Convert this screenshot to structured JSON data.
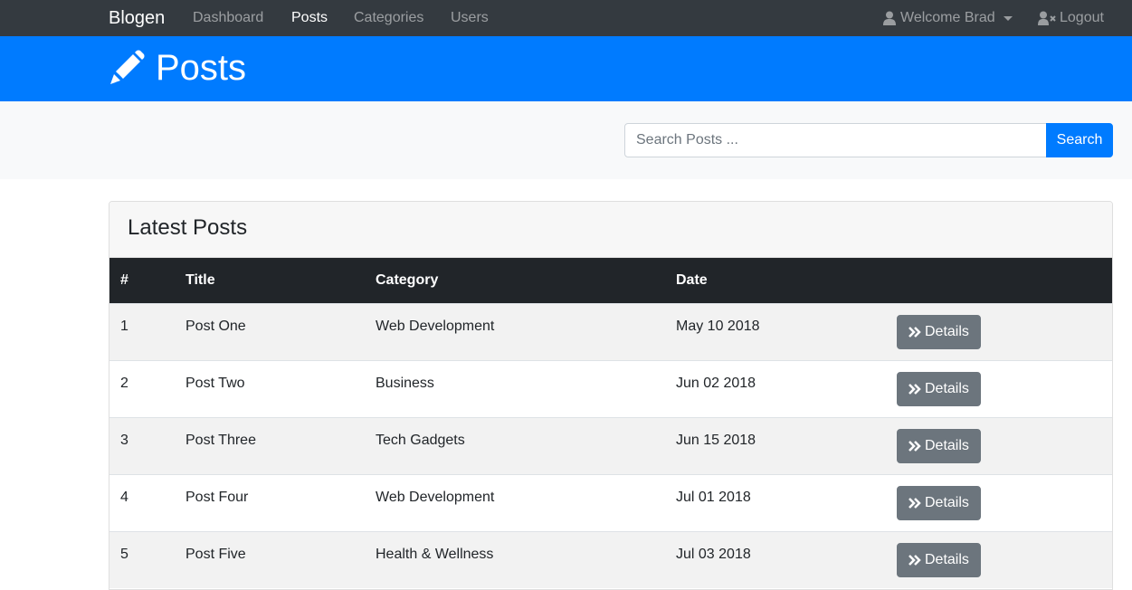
{
  "navbar": {
    "brand": "Blogen",
    "links": [
      {
        "label": "Dashboard",
        "active": false
      },
      {
        "label": "Posts",
        "active": true
      },
      {
        "label": "Categories",
        "active": false
      },
      {
        "label": "Users",
        "active": false
      }
    ],
    "user_label": "Welcome Brad",
    "user_icon": "user-icon",
    "logout_label": "Logout",
    "logout_icon": "user-times-icon"
  },
  "header": {
    "title": "Posts",
    "icon": "pencil-icon",
    "color": "#007bff"
  },
  "search": {
    "placeholder": "Search Posts ...",
    "button_label": "Search"
  },
  "card": {
    "title": "Latest Posts",
    "columns": [
      "#",
      "Title",
      "Category",
      "Date",
      ""
    ],
    "rows": [
      {
        "num": "1",
        "title": "Post One",
        "category": "Web Development",
        "date": "May 10 2018",
        "action": "Details"
      },
      {
        "num": "2",
        "title": "Post Two",
        "category": "Business",
        "date": "Jun 02 2018",
        "action": "Details"
      },
      {
        "num": "3",
        "title": "Post Three",
        "category": "Tech Gadgets",
        "date": "Jun 15 2018",
        "action": "Details"
      },
      {
        "num": "4",
        "title": "Post Four",
        "category": "Web Development",
        "date": "Jul 01 2018",
        "action": "Details"
      },
      {
        "num": "5",
        "title": "Post Five",
        "category": "Health & Wellness",
        "date": "Jul 03 2018",
        "action": "Details"
      }
    ]
  },
  "colors": {
    "navbar_bg": "#343a40",
    "primary": "#007bff",
    "secondary": "#6c757d",
    "table_head": "#212529"
  }
}
